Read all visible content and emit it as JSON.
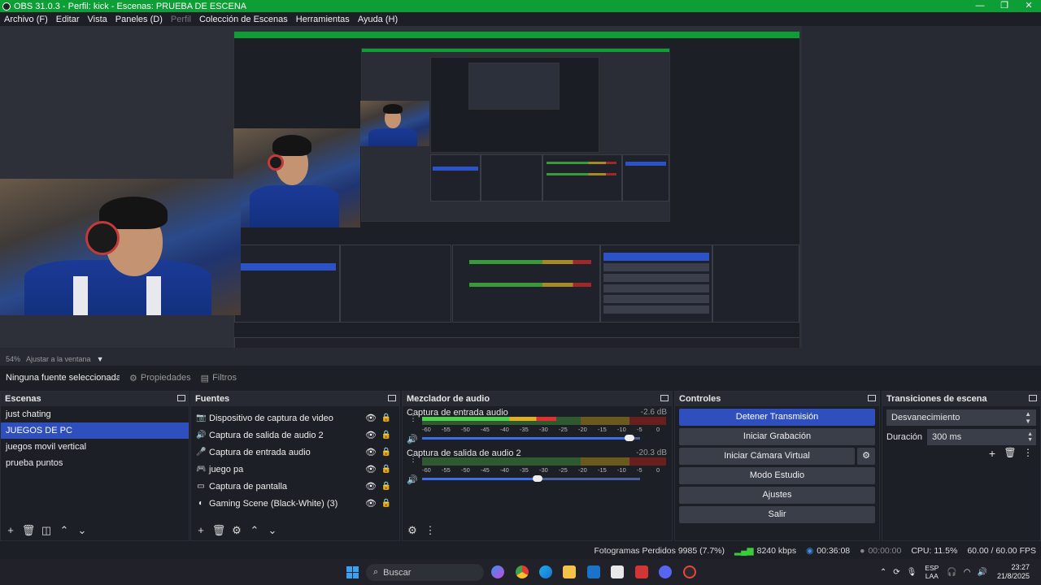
{
  "window": {
    "title": "OBS 31.0.3 - Perfil: kick - Escenas: PRUEBA DE ESCENA",
    "minimize": "—",
    "maximize": "❐",
    "close": "✕"
  },
  "menu": {
    "items": [
      {
        "label": "Archivo (F)",
        "enabled": true
      },
      {
        "label": "Editar",
        "enabled": true
      },
      {
        "label": "Vista",
        "enabled": true
      },
      {
        "label": "Paneles (D)",
        "enabled": true
      },
      {
        "label": "Perfil",
        "enabled": false
      },
      {
        "label": "Colección de Escenas",
        "enabled": true
      },
      {
        "label": "Herramientas",
        "enabled": true
      },
      {
        "label": "Ayuda (H)",
        "enabled": true
      }
    ]
  },
  "preview": {
    "zoom": "54%",
    "scale_mode": "Ajustar a la ventana"
  },
  "source_toolbar": {
    "no_source": "Ninguna fuente seleccionada",
    "properties": "Propiedades",
    "filters": "Filtros"
  },
  "scenes": {
    "title": "Escenas",
    "items": [
      {
        "label": "just chating",
        "active": false
      },
      {
        "label": "JUEGOS DE PC",
        "active": true
      },
      {
        "label": "juegos movil vertical",
        "active": false
      },
      {
        "label": "prueba puntos",
        "active": false
      }
    ]
  },
  "sources": {
    "title": "Fuentes",
    "items": [
      {
        "label": "Dispositivo de captura de video",
        "icon": "camera-icon"
      },
      {
        "label": "Captura de salida de audio 2",
        "icon": "speaker-icon"
      },
      {
        "label": "Captura de entrada audio",
        "icon": "microphone-icon"
      },
      {
        "label": "juego pa",
        "icon": "gamepad-icon"
      },
      {
        "label": "Captura de pantalla",
        "icon": "monitor-icon"
      },
      {
        "label": "Gaming Scene (Black-White) (3)",
        "icon": "scene-icon"
      }
    ]
  },
  "mixer": {
    "title": "Mezclador de audio",
    "ticks": [
      "-60",
      "-55",
      "-50",
      "-45",
      "-40",
      "-35",
      "-30",
      "-25",
      "-20",
      "-15",
      "-10",
      "-5",
      "0"
    ],
    "channels": [
      {
        "name": "Captura de entrada audio",
        "db": "-2.6 dB",
        "level": 0.55,
        "volume": 0.95
      },
      {
        "name": "Captura de salida de audio 2",
        "db": "-20.3 dB",
        "level": 0.0,
        "volume": 0.53
      }
    ]
  },
  "controls": {
    "title": "Controles",
    "stop_stream": "Detener Transmisión",
    "start_recording": "Iniciar Grabación",
    "start_virtual_cam": "Iniciar Cámara Virtual",
    "studio_mode": "Modo Estudio",
    "settings": "Ajustes",
    "exit": "Salir"
  },
  "transitions": {
    "title": "Transiciones de escena",
    "selected": "Desvanecimiento",
    "duration_label": "Duración",
    "duration_value": "300 ms"
  },
  "status": {
    "dropped_frames": "Fotogramas Perdidos 9985 (7.7%)",
    "bitrate": "8240 kbps",
    "stream_time": "00:36:08",
    "record_time": "00:00:00",
    "cpu": "CPU: 11.5%",
    "fps": "60.00 / 60.00 FPS"
  },
  "taskbar": {
    "search_placeholder": "Buscar",
    "lang_top": "ESP",
    "lang_bottom": "LAA",
    "time": "23:27",
    "date": "21/8/2025",
    "colors": {
      "accent": "#2e4fbd",
      "titlebar": "#0d9e35"
    }
  }
}
